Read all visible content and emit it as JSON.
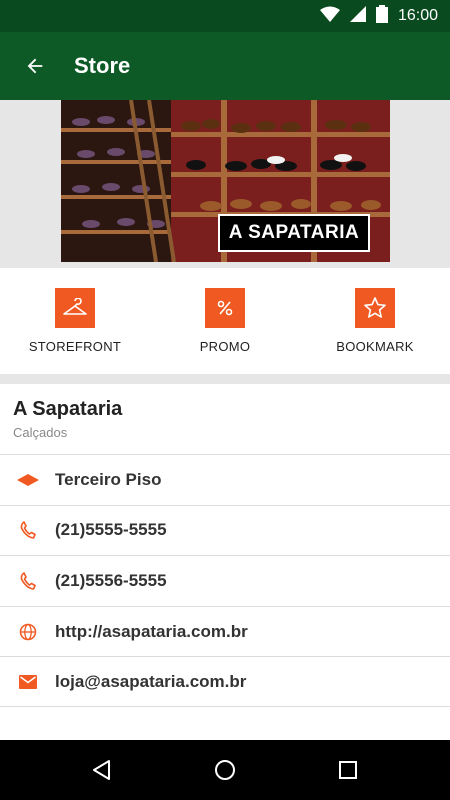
{
  "status_bar": {
    "time": "16:00"
  },
  "app_bar": {
    "title": "Store"
  },
  "banner": {
    "label": "A SAPATARIA"
  },
  "actions": [
    {
      "label": "STOREFRONT",
      "icon": "hanger-icon"
    },
    {
      "label": "PROMO",
      "icon": "percent-icon"
    },
    {
      "label": "BOOKMARK",
      "icon": "star-icon"
    }
  ],
  "store": {
    "name": "A Sapataria",
    "category": "Calçados"
  },
  "info": {
    "floor": "Terceiro Piso",
    "phone1": "(21)5555-5555",
    "phone2": "(21)5556-5555",
    "website": "http://asapataria.com.br",
    "email": "loja@asapataria.com.br"
  },
  "colors": {
    "primary": "#0e5a27",
    "status": "#0a4a1f",
    "accent": "#f05a22"
  }
}
